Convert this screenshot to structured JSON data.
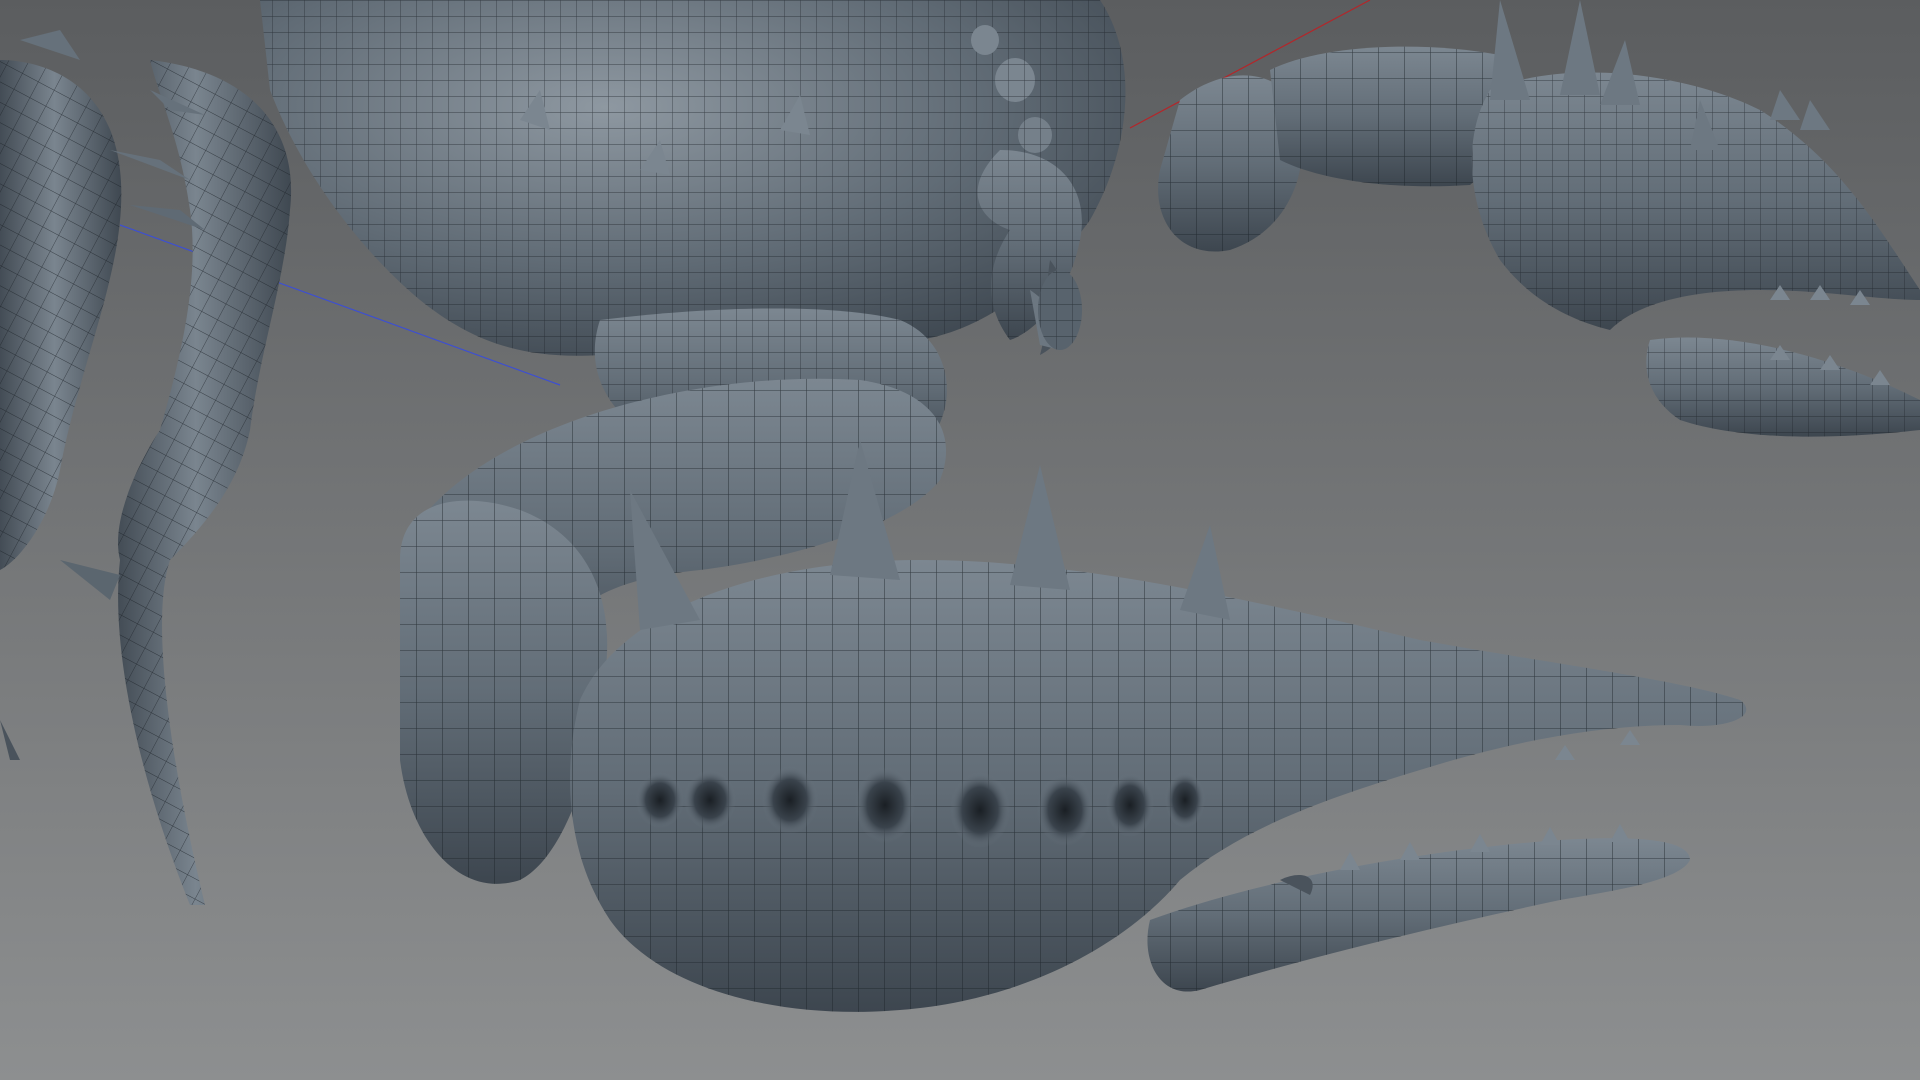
{
  "viewport": {
    "mode": "3d-perspective",
    "display": "shaded-with-wireframe",
    "background_top": "#5b5d5f",
    "background_bottom": "#8d8f90"
  },
  "model": {
    "subject": "crab",
    "surface_color": "#5f6a74",
    "wire_color": "#1b2127"
  },
  "axes": {
    "x_axis_color": "#b3262a",
    "z_axis_color": "#3d4fd1"
  }
}
